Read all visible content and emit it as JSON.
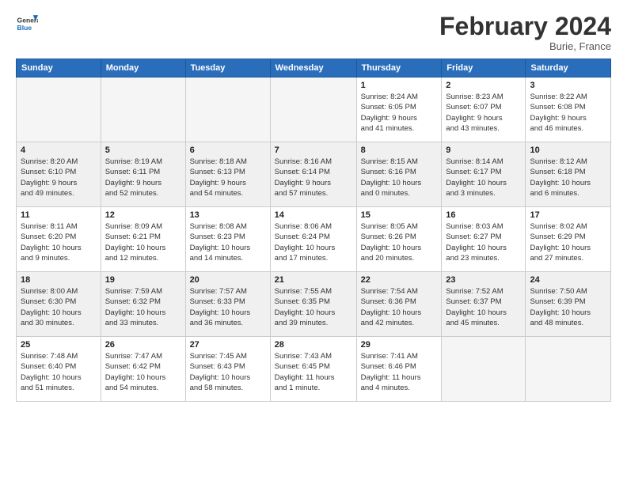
{
  "header": {
    "logo_general": "General",
    "logo_blue": "Blue",
    "month_title": "February 2024",
    "location": "Burie, France"
  },
  "weekdays": [
    "Sunday",
    "Monday",
    "Tuesday",
    "Wednesday",
    "Thursday",
    "Friday",
    "Saturday"
  ],
  "weeks": [
    [
      {
        "num": "",
        "info": ""
      },
      {
        "num": "",
        "info": ""
      },
      {
        "num": "",
        "info": ""
      },
      {
        "num": "",
        "info": ""
      },
      {
        "num": "1",
        "info": "Sunrise: 8:24 AM\nSunset: 6:05 PM\nDaylight: 9 hours\nand 41 minutes."
      },
      {
        "num": "2",
        "info": "Sunrise: 8:23 AM\nSunset: 6:07 PM\nDaylight: 9 hours\nand 43 minutes."
      },
      {
        "num": "3",
        "info": "Sunrise: 8:22 AM\nSunset: 6:08 PM\nDaylight: 9 hours\nand 46 minutes."
      }
    ],
    [
      {
        "num": "4",
        "info": "Sunrise: 8:20 AM\nSunset: 6:10 PM\nDaylight: 9 hours\nand 49 minutes."
      },
      {
        "num": "5",
        "info": "Sunrise: 8:19 AM\nSunset: 6:11 PM\nDaylight: 9 hours\nand 52 minutes."
      },
      {
        "num": "6",
        "info": "Sunrise: 8:18 AM\nSunset: 6:13 PM\nDaylight: 9 hours\nand 54 minutes."
      },
      {
        "num": "7",
        "info": "Sunrise: 8:16 AM\nSunset: 6:14 PM\nDaylight: 9 hours\nand 57 minutes."
      },
      {
        "num": "8",
        "info": "Sunrise: 8:15 AM\nSunset: 6:16 PM\nDaylight: 10 hours\nand 0 minutes."
      },
      {
        "num": "9",
        "info": "Sunrise: 8:14 AM\nSunset: 6:17 PM\nDaylight: 10 hours\nand 3 minutes."
      },
      {
        "num": "10",
        "info": "Sunrise: 8:12 AM\nSunset: 6:18 PM\nDaylight: 10 hours\nand 6 minutes."
      }
    ],
    [
      {
        "num": "11",
        "info": "Sunrise: 8:11 AM\nSunset: 6:20 PM\nDaylight: 10 hours\nand 9 minutes."
      },
      {
        "num": "12",
        "info": "Sunrise: 8:09 AM\nSunset: 6:21 PM\nDaylight: 10 hours\nand 12 minutes."
      },
      {
        "num": "13",
        "info": "Sunrise: 8:08 AM\nSunset: 6:23 PM\nDaylight: 10 hours\nand 14 minutes."
      },
      {
        "num": "14",
        "info": "Sunrise: 8:06 AM\nSunset: 6:24 PM\nDaylight: 10 hours\nand 17 minutes."
      },
      {
        "num": "15",
        "info": "Sunrise: 8:05 AM\nSunset: 6:26 PM\nDaylight: 10 hours\nand 20 minutes."
      },
      {
        "num": "16",
        "info": "Sunrise: 8:03 AM\nSunset: 6:27 PM\nDaylight: 10 hours\nand 23 minutes."
      },
      {
        "num": "17",
        "info": "Sunrise: 8:02 AM\nSunset: 6:29 PM\nDaylight: 10 hours\nand 27 minutes."
      }
    ],
    [
      {
        "num": "18",
        "info": "Sunrise: 8:00 AM\nSunset: 6:30 PM\nDaylight: 10 hours\nand 30 minutes."
      },
      {
        "num": "19",
        "info": "Sunrise: 7:59 AM\nSunset: 6:32 PM\nDaylight: 10 hours\nand 33 minutes."
      },
      {
        "num": "20",
        "info": "Sunrise: 7:57 AM\nSunset: 6:33 PM\nDaylight: 10 hours\nand 36 minutes."
      },
      {
        "num": "21",
        "info": "Sunrise: 7:55 AM\nSunset: 6:35 PM\nDaylight: 10 hours\nand 39 minutes."
      },
      {
        "num": "22",
        "info": "Sunrise: 7:54 AM\nSunset: 6:36 PM\nDaylight: 10 hours\nand 42 minutes."
      },
      {
        "num": "23",
        "info": "Sunrise: 7:52 AM\nSunset: 6:37 PM\nDaylight: 10 hours\nand 45 minutes."
      },
      {
        "num": "24",
        "info": "Sunrise: 7:50 AM\nSunset: 6:39 PM\nDaylight: 10 hours\nand 48 minutes."
      }
    ],
    [
      {
        "num": "25",
        "info": "Sunrise: 7:48 AM\nSunset: 6:40 PM\nDaylight: 10 hours\nand 51 minutes."
      },
      {
        "num": "26",
        "info": "Sunrise: 7:47 AM\nSunset: 6:42 PM\nDaylight: 10 hours\nand 54 minutes."
      },
      {
        "num": "27",
        "info": "Sunrise: 7:45 AM\nSunset: 6:43 PM\nDaylight: 10 hours\nand 58 minutes."
      },
      {
        "num": "28",
        "info": "Sunrise: 7:43 AM\nSunset: 6:45 PM\nDaylight: 11 hours\nand 1 minute."
      },
      {
        "num": "29",
        "info": "Sunrise: 7:41 AM\nSunset: 6:46 PM\nDaylight: 11 hours\nand 4 minutes."
      },
      {
        "num": "",
        "info": ""
      },
      {
        "num": "",
        "info": ""
      }
    ]
  ]
}
